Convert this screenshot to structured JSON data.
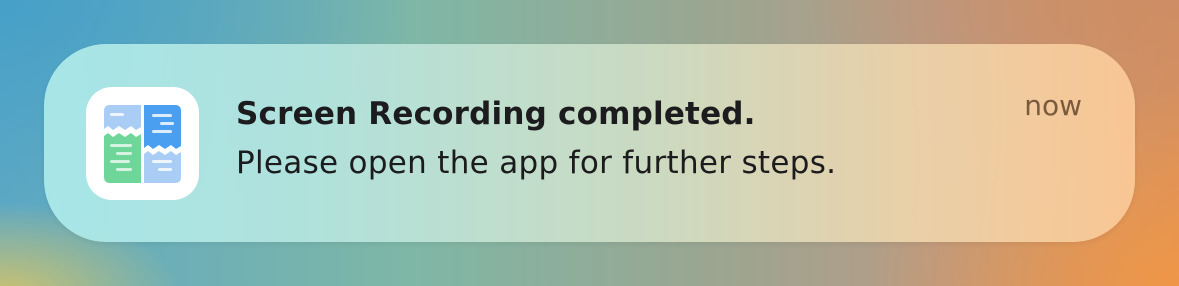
{
  "notification": {
    "app_icon": "screen-recording-app-icon",
    "title": "Screen Recording completed.",
    "body": "Please open the app for further steps.",
    "time": "now"
  },
  "colors": {
    "title_text": "#1c1c1e",
    "time_text": "#7a5a3e",
    "icon_blue_light": "#a9cdf5",
    "icon_blue": "#4a9ff0",
    "icon_green": "#6fd69a",
    "icon_background": "#ffffff"
  }
}
